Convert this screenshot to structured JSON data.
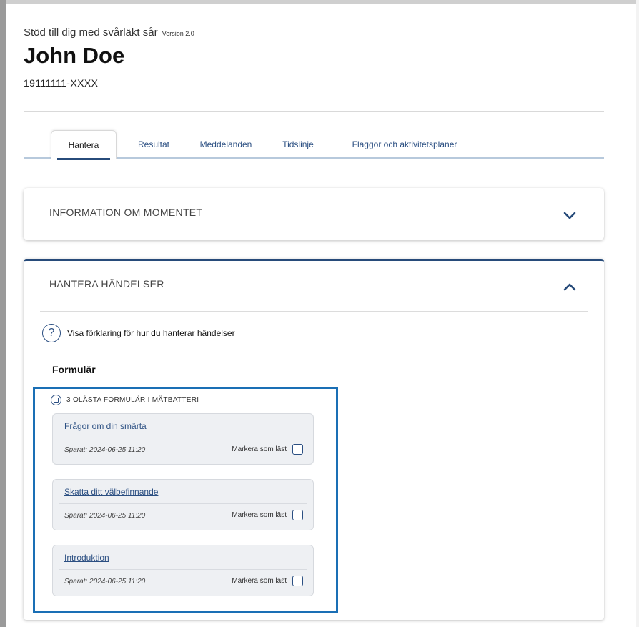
{
  "header": {
    "app_title": "Stöd till dig med svårläkt sår",
    "version": "Version 2.0",
    "patient_name": "John Doe",
    "patient_id": "19111111-XXXX"
  },
  "tabs": [
    {
      "label": "Hantera",
      "active": true
    },
    {
      "label": "Resultat",
      "active": false
    },
    {
      "label": "Meddelanden",
      "active": false
    },
    {
      "label": "Tidslinje",
      "active": false
    },
    {
      "label": "Flaggor och aktivitetsplaner",
      "active": false
    }
  ],
  "info_section": {
    "title": "INFORMATION OM MOMENTET",
    "expanded": false,
    "icon": "chevron-down-icon"
  },
  "events_section": {
    "title": "HANTERA HÄNDELSER",
    "expanded": true,
    "icon": "chevron-up-icon",
    "help_icon": "?",
    "help_text": "Visa förklaring för hur du hanterar händelser",
    "forms_heading": "Formulär",
    "batch_label": "3 OLÄSTA FORMULÄR I MÄTBATTERI",
    "forms": [
      {
        "title": "Frågor om din smärta",
        "saved": "Sparat: 2024-06-25 11:20",
        "mark_label": "Markera som läst"
      },
      {
        "title": "Skatta ditt välbefinnande",
        "saved": "Sparat: 2024-06-25 11:20",
        "mark_label": "Markera som läst"
      },
      {
        "title": "Introduktion",
        "saved": "Sparat: 2024-06-25 11:20",
        "mark_label": "Markera som läst"
      }
    ]
  },
  "colors": {
    "accent": "#274b7a",
    "link": "#2b4f82",
    "highlight": "#1a6fb5",
    "form_card_bg": "#eef0f3"
  }
}
